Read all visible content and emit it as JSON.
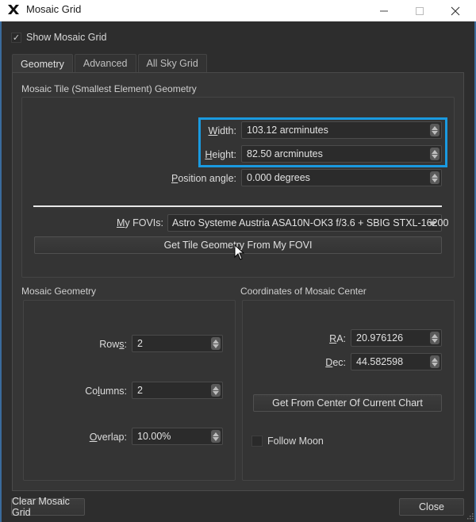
{
  "window": {
    "title": "Mosaic Grid",
    "app_icon": "app-x-icon",
    "controls": [
      "minimize-icon",
      "maximize-icon",
      "close-icon"
    ]
  },
  "show_mosaic_grid": {
    "label": "Show Mosaic Grid",
    "checked": true
  },
  "tabs": [
    {
      "label": "Geometry",
      "active": true
    },
    {
      "label": "Advanced",
      "active": false
    },
    {
      "label": "All Sky Grid",
      "active": false
    }
  ],
  "tile_geometry": {
    "title": "Mosaic Tile (Smallest Element) Geometry",
    "width": {
      "label": "Width:",
      "value": "103.12 arcminutes"
    },
    "height": {
      "label": "Height:",
      "value": "82.50 arcminutes"
    },
    "position_angle": {
      "label": "Position angle:",
      "value": "0.000 degrees"
    },
    "my_fovis": {
      "label": "My FOVIs:",
      "value": "Astro Systeme Austria ASA10N-OK3 f/3.6 + SBIG STXL-16200"
    },
    "get_tile_button": "Get Tile Geometry From My FOVI",
    "highlight_color": "#1a9ae0"
  },
  "mosaic_geometry": {
    "title": "Mosaic Geometry",
    "rows": {
      "label": "Rows:",
      "value": "2"
    },
    "columns": {
      "label": "Columns:",
      "value": "2"
    },
    "overlap": {
      "label": "Overlap:",
      "value": "10.00%"
    }
  },
  "mosaic_center": {
    "title": "Coordinates of Mosaic Center",
    "ra": {
      "label": "RA:",
      "value": "20.976126"
    },
    "dec": {
      "label": "Dec:",
      "value": "44.582598"
    },
    "get_center_button": "Get From Center Of Current Chart",
    "follow_moon": {
      "label": "Follow Moon",
      "checked": false
    }
  },
  "footer": {
    "clear_button": "Clear Mosaic Grid",
    "close_button": "Close"
  }
}
